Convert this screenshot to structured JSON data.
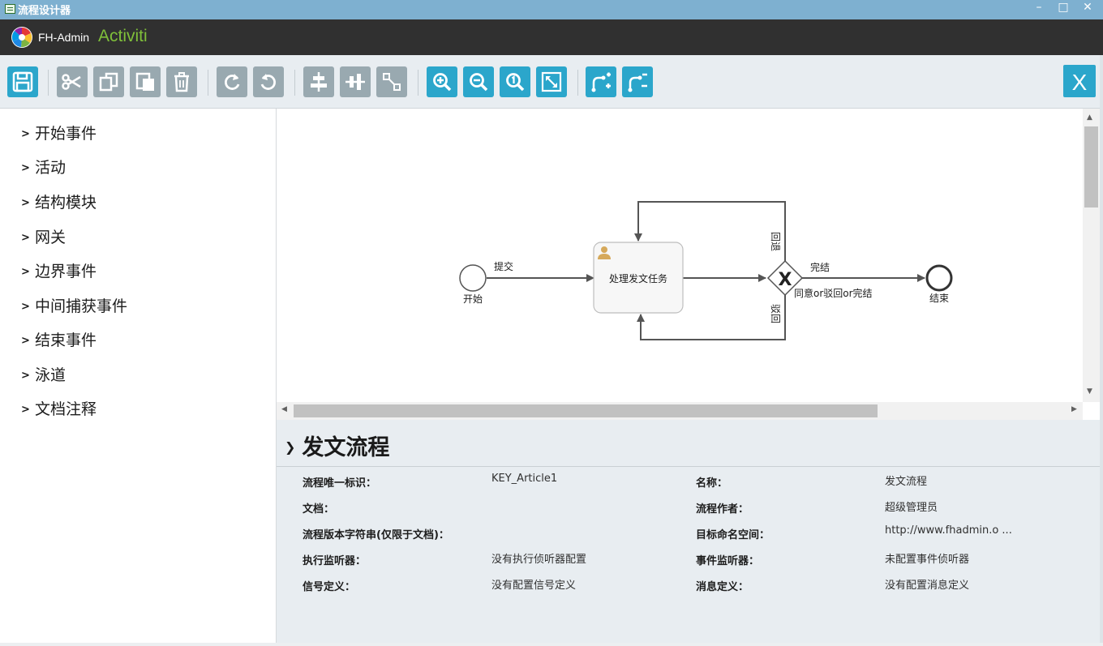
{
  "window": {
    "title": "流程设计器",
    "minimize": "–",
    "maximize": "□",
    "close": "✕"
  },
  "header": {
    "brand": "FH-Admin",
    "product": "Activiti"
  },
  "toolbar": {
    "buttons": [
      {
        "name": "save",
        "icon": "save-icon"
      },
      {
        "name": "cut",
        "icon": "scissors-icon"
      },
      {
        "name": "copy",
        "icon": "copy-icon"
      },
      {
        "name": "paste",
        "icon": "paste-icon"
      },
      {
        "name": "delete",
        "icon": "trash-icon"
      },
      {
        "name": "redo",
        "icon": "redo-icon"
      },
      {
        "name": "undo",
        "icon": "undo-icon"
      },
      {
        "name": "align-vertical",
        "icon": "align-vertical-icon"
      },
      {
        "name": "align-horizontal",
        "icon": "align-horizontal-icon"
      },
      {
        "name": "same-size",
        "icon": "same-size-icon"
      },
      {
        "name": "zoom-in",
        "icon": "zoom-in-icon"
      },
      {
        "name": "zoom-out",
        "icon": "zoom-out-icon"
      },
      {
        "name": "zoom-actual",
        "icon": "zoom-actual-icon"
      },
      {
        "name": "zoom-fit",
        "icon": "zoom-fit-icon"
      },
      {
        "name": "add-bendpoint",
        "icon": "add-bendpoint-icon"
      },
      {
        "name": "remove-bendpoint",
        "icon": "remove-bendpoint-icon"
      }
    ],
    "close_label": "X"
  },
  "palette": {
    "items": [
      "开始事件",
      "活动",
      "结构模块",
      "网关",
      "边界事件",
      "中间捕获事件",
      "结束事件",
      "泳道",
      "文档注释"
    ]
  },
  "diagram": {
    "start_label": "开始",
    "task_label": "处理发文任务",
    "end_label": "结束",
    "flow_submit": "提交",
    "flow_complete": "完结",
    "flow_return_top": "回退",
    "flow_return_bottom": "驳回",
    "gateway_label": "同意or驳回or完结",
    "gateway_symbol": "X"
  },
  "properties": {
    "title": "发文流程",
    "fields": [
      {
        "label": "流程唯一标识：",
        "value": "KEY_Article1"
      },
      {
        "label": "名称：",
        "value": "发文流程"
      },
      {
        "label": "文档：",
        "value": ""
      },
      {
        "label": "流程作者：",
        "value": "超级管理员"
      },
      {
        "label": "流程版本字符串(仅限于文档)：",
        "value": ""
      },
      {
        "label": "目标命名空间：",
        "value": "http://www.fhadmin.o ..."
      },
      {
        "label": "执行监听器：",
        "value": "没有执行侦听器配置"
      },
      {
        "label": "事件监听器：",
        "value": "未配置事件侦听器"
      },
      {
        "label": "信号定义：",
        "value": "没有配置信号定义"
      },
      {
        "label": "消息定义：",
        "value": "没有配置消息定义"
      }
    ]
  }
}
